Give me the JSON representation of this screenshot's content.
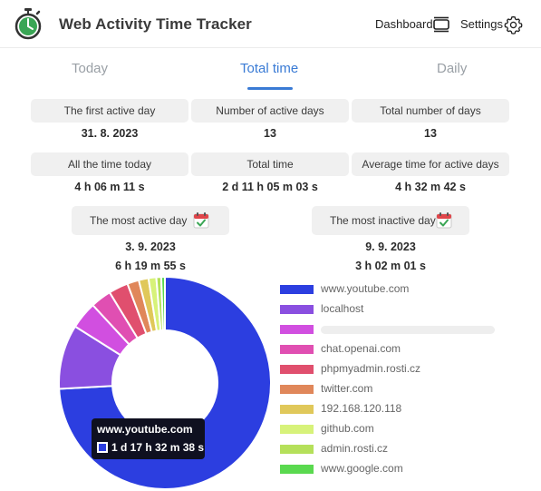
{
  "header": {
    "app_title": "Web Activity Time Tracker",
    "dashboard_label": "Dashboard",
    "settings_label": "Settings"
  },
  "tabs": [
    {
      "label": "Today",
      "active": false
    },
    {
      "label": "Total time",
      "active": true
    },
    {
      "label": "Daily",
      "active": false
    }
  ],
  "stats": [
    {
      "label": "The first active day",
      "value": "31. 8. 2023"
    },
    {
      "label": "Number of active days",
      "value": "13"
    },
    {
      "label": "Total number of days",
      "value": "13"
    },
    {
      "label": "All the time today",
      "value": "4 h 06 m 11 s"
    },
    {
      "label": "Total time",
      "value": "2 d 11 h 05 m 03 s"
    },
    {
      "label": "Average time for active days",
      "value": "4 h 32 m 42 s"
    }
  ],
  "most_active": {
    "label": "The most active day",
    "date": "3. 9. 2023",
    "time": "6 h 19 m 55 s"
  },
  "most_inactive": {
    "label": "The most inactive day",
    "date": "9. 9. 2023",
    "time": "3 h 02 m 01 s"
  },
  "colors": {
    "accent": "#3a7bd5",
    "logo_green": "#3aa655"
  },
  "tooltip": {
    "title": "www.youtube.com",
    "value": "1 d 17 h 32 m 38 s"
  },
  "chart_data": {
    "type": "pie",
    "variant": "doughnut",
    "legend_position": "right",
    "categories": [
      "www.youtube.com",
      "localhost",
      "",
      "chat.openai.com",
      "phpmyadmin.rosti.cz",
      "twitter.com",
      "192.168.120.118",
      "github.com",
      "admin.rosti.cz",
      "www.google.com"
    ],
    "label_redacted": [
      false,
      false,
      true,
      false,
      false,
      false,
      false,
      false,
      false,
      false
    ],
    "values": [
      149558,
      19800,
      8400,
      6400,
      6000,
      3600,
      3000,
      2400,
      1500,
      1120
    ],
    "colors": [
      "#2c3ee0",
      "#8a4fe0",
      "#d14fe0",
      "#e04fb2",
      "#e04f6e",
      "#e0875a",
      "#e0c85a",
      "#d7f27a",
      "#b5e05a",
      "#5ad94f"
    ]
  }
}
